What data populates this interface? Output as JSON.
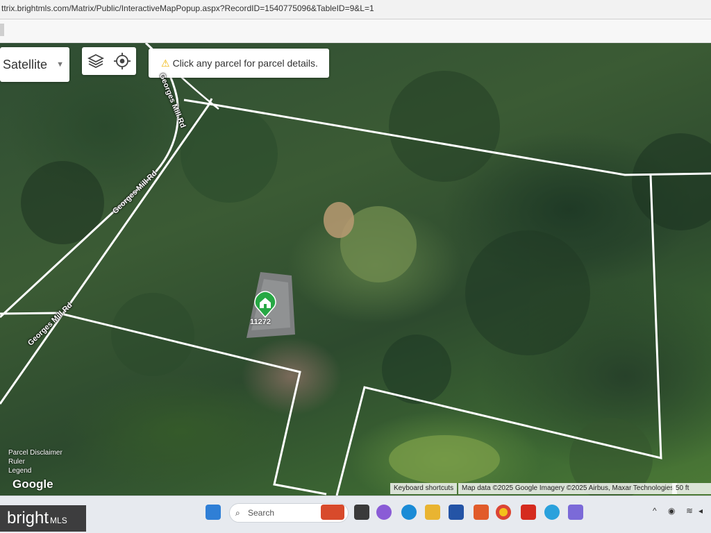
{
  "browser": {
    "url": "ttrix.brightmls.com/Matrix/Public/InteractiveMapPopup.aspx?RecordID=1540775096&TableID=9&L=1"
  },
  "map": {
    "layer_select": {
      "selected": "Satellite"
    },
    "icons": {
      "layers": "layers-icon",
      "locate": "target-icon",
      "warning": "warning-icon"
    },
    "hint": "Click any parcel for parcel details.",
    "streets": [
      "Georges Mill Rd",
      "Georges Mill Rd",
      "Georges Mill Rd"
    ],
    "pin_label": "11272",
    "links": {
      "disclaimer": "Parcel Disclaimer",
      "ruler": "Ruler",
      "legend": "Legend"
    },
    "google": "Google",
    "attribution": {
      "shortcuts": "Keyboard shortcuts",
      "data": "Map data ©2025 Google Imagery ©2025 Airbus, Maxar Technologies",
      "scale": "50 ft"
    },
    "colors": {
      "parcel_line": "#ffffff",
      "pin": "#27a844"
    }
  },
  "taskbar": {
    "search_placeholder": "Search"
  },
  "watermark": {
    "bright": "bright",
    "mls": "MLS"
  }
}
